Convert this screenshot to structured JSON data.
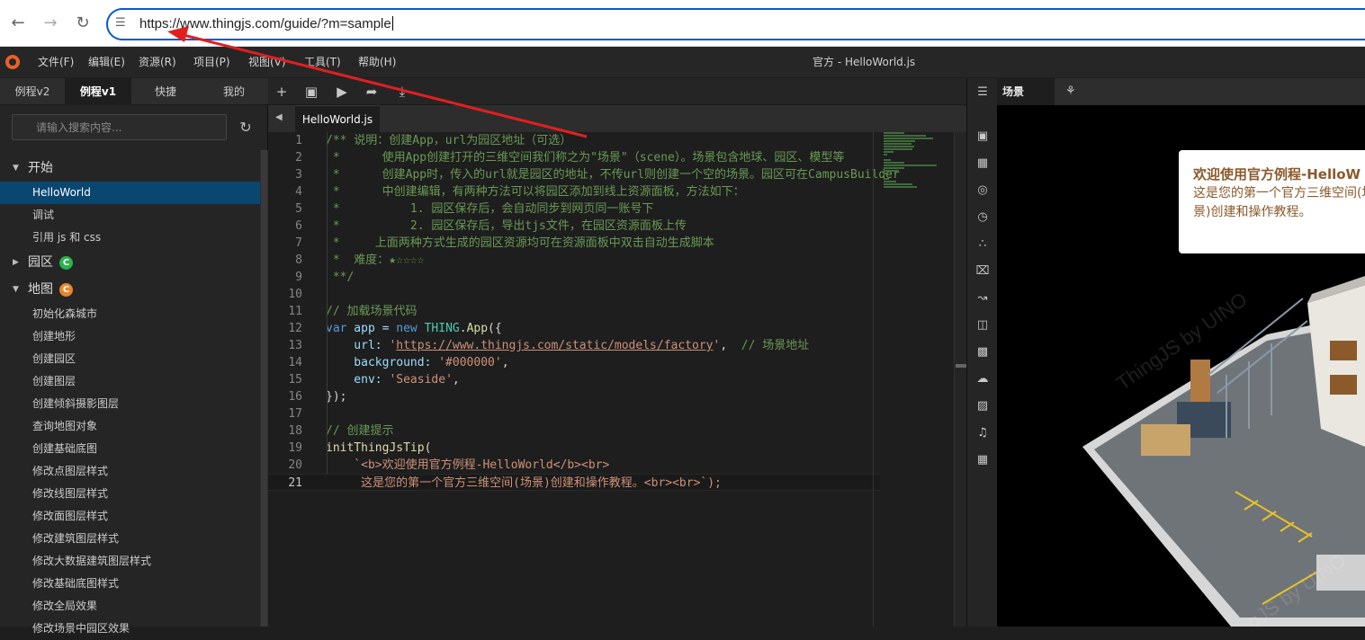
{
  "browser": {
    "url": "https://www.thingjs.com/guide/?m=sample"
  },
  "menubar": {
    "items": [
      "文件(F)",
      "编辑(E)",
      "资源(R)",
      "项目(P)",
      "视图(V)",
      "工具(T)",
      "帮助(H)"
    ],
    "window_title": "官方 - HelloWorld.js"
  },
  "left_panel": {
    "tabs": [
      "例程v2",
      "例程v1",
      "快捷",
      "我的"
    ],
    "active_tab": "例程v1",
    "search_placeholder": "请输入搜索内容...",
    "groups": [
      {
        "label": "开始",
        "expanded": true,
        "items": [
          "HelloWorld",
          "调试",
          "引用 js 和 css"
        ]
      },
      {
        "label": "园区",
        "expanded": false,
        "badge": "C",
        "badge_color": "#2bb24c",
        "items": []
      },
      {
        "label": "地图",
        "expanded": true,
        "badge": "C",
        "badge_color": "#e8862c",
        "items": [
          "初始化森城市",
          "创建地形",
          "创建园区",
          "创建图层",
          "创建倾斜摄影图层",
          "查询地图对象",
          "创建基础底图",
          "修改点图层样式",
          "修改线图层样式",
          "修改面图层样式",
          "修改建筑图层样式",
          "修改大数据建筑图层样式",
          "修改基础底图样式",
          "修改全局效果",
          "修改场景中园区效果"
        ]
      }
    ],
    "selected_item": "HelloWorld"
  },
  "editor": {
    "file_tab": "HelloWorld.js",
    "current_line": 21,
    "lines": [
      {
        "n": "1",
        "t": "/** 说明：创建App，url为园区地址（可选）"
      },
      {
        "n": "2",
        "t": " *      使用App创建打开的三维空间我们称之为\"场景\"（scene）。场景包含地球、园区、模型等"
      },
      {
        "n": "3",
        "t": " *      创建App时，传入的url就是园区的地址，不传url则创建一个空的场景。园区可在CampusBuilder"
      },
      {
        "n": "4",
        "t": " *      中创建编辑，有两种方法可以将园区添加到线上资源面板，方法如下："
      },
      {
        "n": "5",
        "t": " *          1. 园区保存后，会自动同步到网页同一账号下"
      },
      {
        "n": "6",
        "t": " *          2. 园区保存后，导出tjs文件，在园区资源面板上传"
      },
      {
        "n": "7",
        "t": " *     上面两种方式生成的园区资源均可在资源面板中双击自动生成脚本"
      },
      {
        "n": "8",
        "t": " *  难度：★☆☆☆☆"
      },
      {
        "n": "9",
        "t": " **/"
      },
      {
        "n": "10",
        "t": ""
      },
      {
        "n": "11",
        "t": "// 加载场景代码"
      },
      {
        "n": "12",
        "t": "var app = new THING.App({"
      },
      {
        "n": "13",
        "t": "    url: 'https://www.thingjs.com/static/models/factory',  // 场景地址"
      },
      {
        "n": "14",
        "t": "    background: '#000000',"
      },
      {
        "n": "15",
        "t": "    env: 'Seaside',"
      },
      {
        "n": "16",
        "t": "});"
      },
      {
        "n": "17",
        "t": ""
      },
      {
        "n": "18",
        "t": "// 创建提示"
      },
      {
        "n": "19",
        "t": "initThingJsTip("
      },
      {
        "n": "20",
        "t": "    `<b>欢迎使用官方例程-HelloWorld</b><br>"
      },
      {
        "n": "21",
        "t": "     这是您的第一个官方三维空间(场景)创建和操作教程。<br><br>`);"
      }
    ]
  },
  "right_panel": {
    "scene_tab": "场景",
    "tip": {
      "title": "欢迎使用官方例程-HelloW",
      "body": "这是您的第一个官方三维空间(场景)创建和操作教程。"
    },
    "watermark": "ThingJS by UINO"
  },
  "colors": {
    "accent": "#0b57d0",
    "selection": "#094771",
    "annotation_arrow": "#e0201f"
  }
}
